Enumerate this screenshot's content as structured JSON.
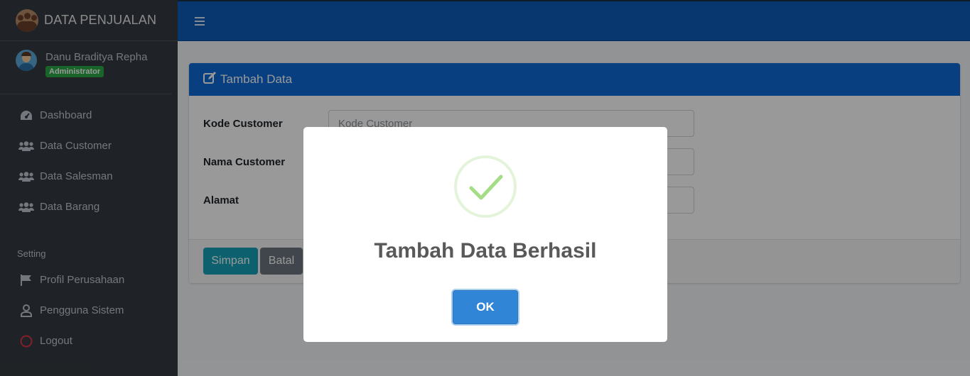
{
  "sidebar": {
    "brand": "DATA PENJUALAN",
    "user_name": "Danu Braditya Repha",
    "user_role": "Administrator",
    "items": [
      {
        "label": "Dashboard",
        "icon": "tachometer-icon"
      },
      {
        "label": "Data Customer",
        "icon": "users-icon"
      },
      {
        "label": "Data Salesman",
        "icon": "users-icon"
      },
      {
        "label": "Data Barang",
        "icon": "users-icon"
      }
    ],
    "setting_header": "Setting",
    "setting_items": [
      {
        "label": "Profil Perusahaan",
        "icon": "flag-icon"
      },
      {
        "label": "Pengguna Sistem",
        "icon": "user-icon"
      },
      {
        "label": "Logout",
        "icon": "circle-icon"
      }
    ]
  },
  "card": {
    "title": "Tambah Data",
    "fields": [
      {
        "label": "Kode Customer",
        "placeholder": "Kode Customer"
      },
      {
        "label": "Nama Customer",
        "placeholder": ""
      },
      {
        "label": "Alamat",
        "placeholder": ""
      }
    ],
    "save_label": "Simpan",
    "cancel_label": "Batal"
  },
  "modal": {
    "title": "Tambah Data Berhasil",
    "ok_label": "OK",
    "icon": "success-check-icon"
  },
  "colors": {
    "sidebar_bg": "#343a40",
    "navbar_bg": "#0d5cb8",
    "card_header_bg": "#0d6ad6",
    "badge": "#28a745",
    "save_button": "#17a2b8",
    "cancel_button": "#6c757d",
    "ok_button": "#3085d6",
    "success_check": "#a5dc86",
    "logout_icon": "#dc3545"
  }
}
